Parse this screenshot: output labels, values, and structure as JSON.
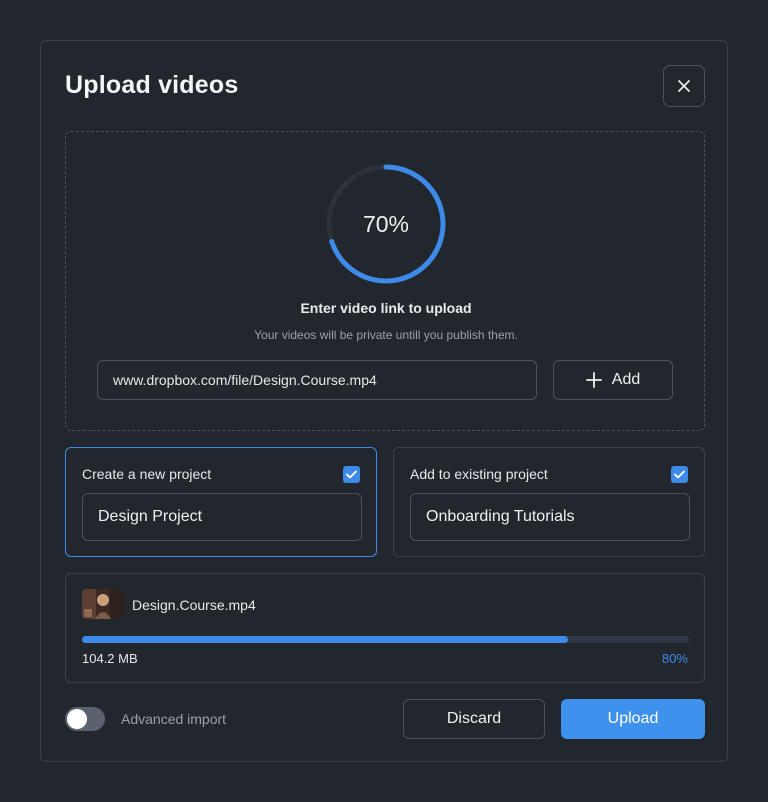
{
  "dialog": {
    "title": "Upload videos"
  },
  "dropzone": {
    "progress_percent": 70,
    "progress_label": "70%",
    "heading": "Enter video link to upload",
    "subtext": "Your videos will be private untill you publish them.",
    "link_value": "www.dropbox.com/file/Design.Course.mp4",
    "add_label": "Add"
  },
  "projects": {
    "new": {
      "label": "Create a new project",
      "checked": true,
      "value": "Design Project"
    },
    "existing": {
      "label": "Add to existing project",
      "checked": true,
      "value": "Onboarding Tutorials"
    }
  },
  "file": {
    "name": "Design.Course.mp4",
    "size": "104.2 MB",
    "progress_percent": 80,
    "progress_label": "80%"
  },
  "footer": {
    "advanced_import_label": "Advanced import",
    "advanced_import_on": false,
    "discard_label": "Discard",
    "upload_label": "Upload"
  },
  "colors": {
    "accent": "#3d8ae8",
    "background": "#22272e",
    "border": "#3b424b"
  },
  "icons": {
    "close": "close-icon",
    "add": "plus-icon",
    "check": "check-icon"
  }
}
